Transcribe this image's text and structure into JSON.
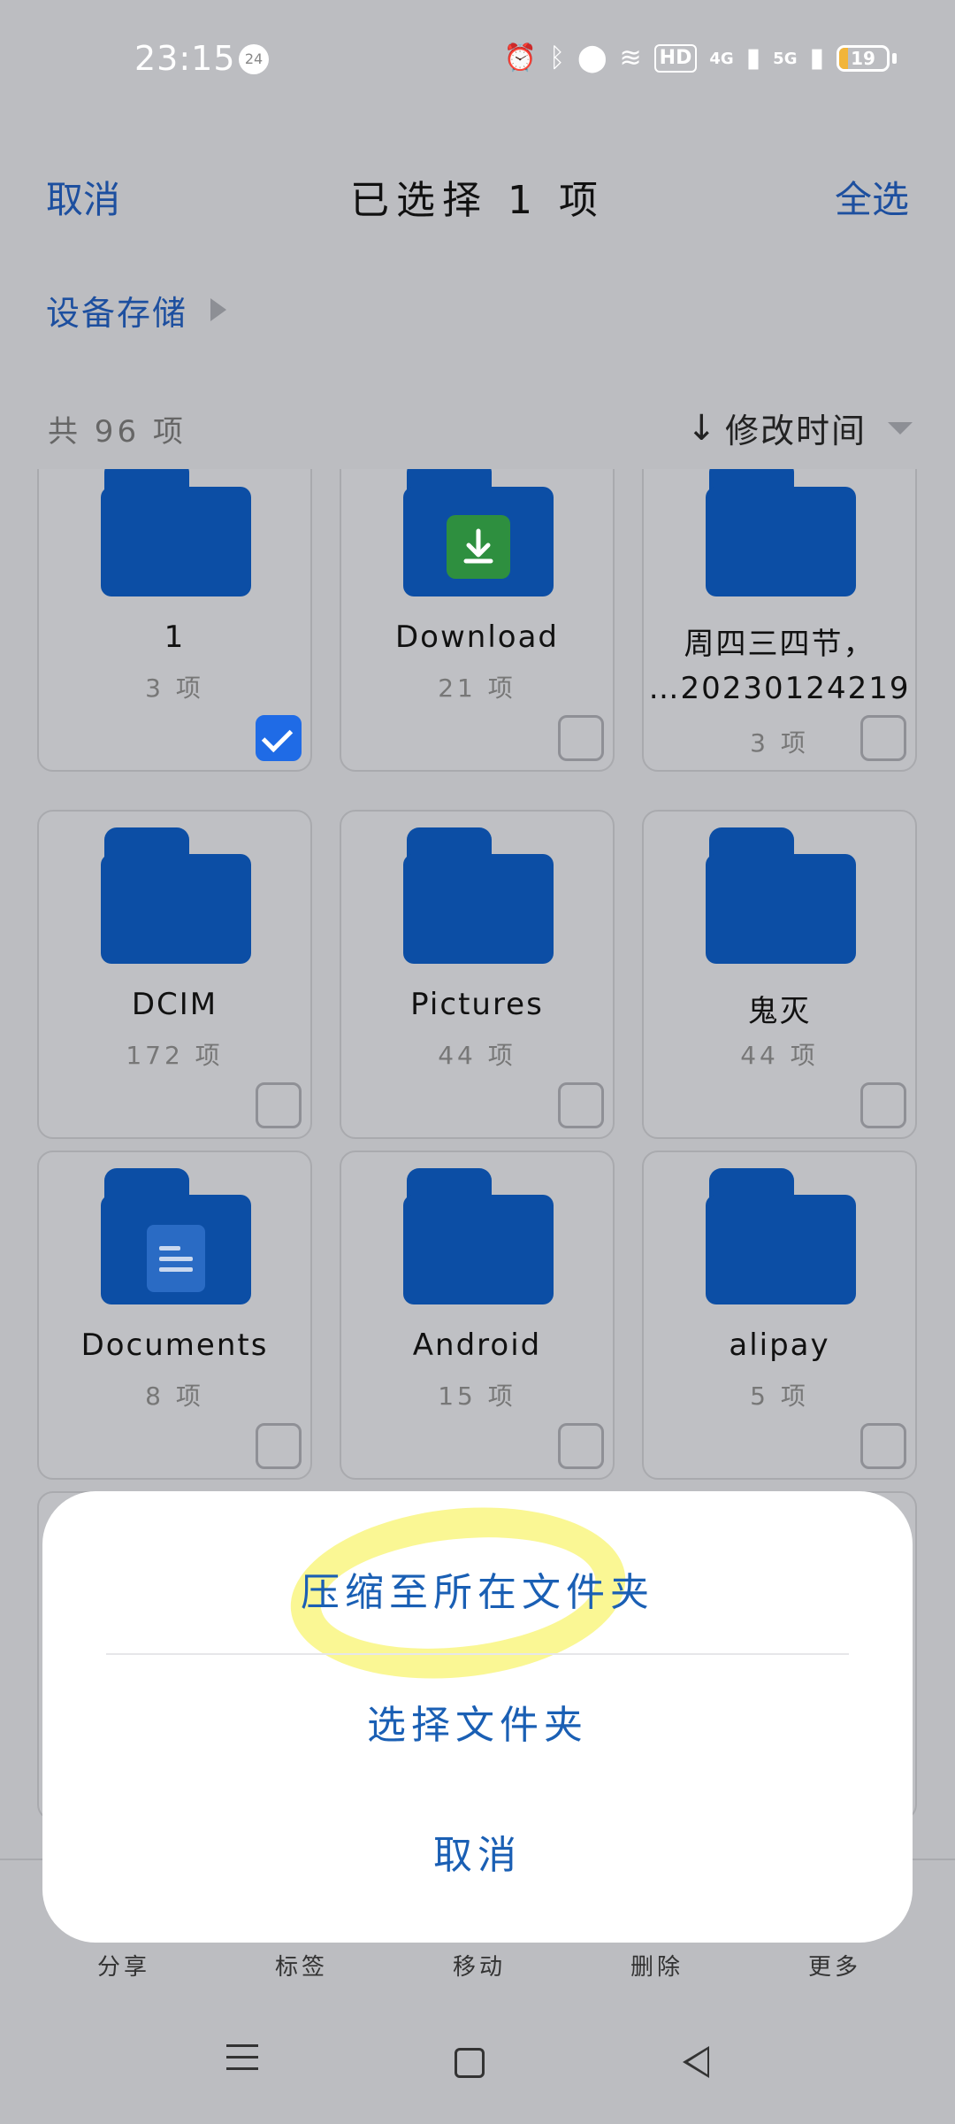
{
  "status_bar": {
    "time": "23:15",
    "badge": "24",
    "hd_label": "HD",
    "net1": "4G",
    "net2": "5G",
    "battery_percent": 19,
    "battery_text": "19",
    "icons": [
      "alarm-icon",
      "bluetooth-icon",
      "location-icon",
      "wifi-icon",
      "signal-icon",
      "signal-icon",
      "battery-icon"
    ]
  },
  "header": {
    "cancel": "取消",
    "title": "已选择 1 项",
    "select_all": "全选"
  },
  "breadcrumb": {
    "label": "设备存储"
  },
  "summary": {
    "count": "共 96 项",
    "sort_label": "修改时间",
    "sort_arrow": "↓"
  },
  "folders": [
    {
      "name": "1",
      "count": "3 项",
      "checked": true
    },
    {
      "name": "Download",
      "count": "21 项",
      "checked": false,
      "badge": "download"
    },
    {
      "name": "周四三四节，",
      "name2": "…20230124219",
      "count": "3 项",
      "checked": false
    },
    {
      "name": "DCIM",
      "count": "172 项",
      "checked": false
    },
    {
      "name": "Pictures",
      "count": "44 项",
      "checked": false
    },
    {
      "name": "鬼灭",
      "count": "44 项",
      "checked": false
    },
    {
      "name": "Documents",
      "count": "8 项",
      "checked": false,
      "badge": "document"
    },
    {
      "name": "Android",
      "count": "15 项",
      "checked": false
    },
    {
      "name": "alipay",
      "count": "5 项",
      "checked": false
    }
  ],
  "toolbar": {
    "items": [
      "分享",
      "标签",
      "移动",
      "删除",
      "更多"
    ]
  },
  "sheet": {
    "options": [
      "压缩至所在文件夹",
      "选择文件夹",
      "取消"
    ]
  },
  "colors": {
    "accent": "#1d4f9f",
    "folder": "#0c4ea5",
    "checked": "#1f6be6",
    "highlight": "#f5f03c"
  }
}
